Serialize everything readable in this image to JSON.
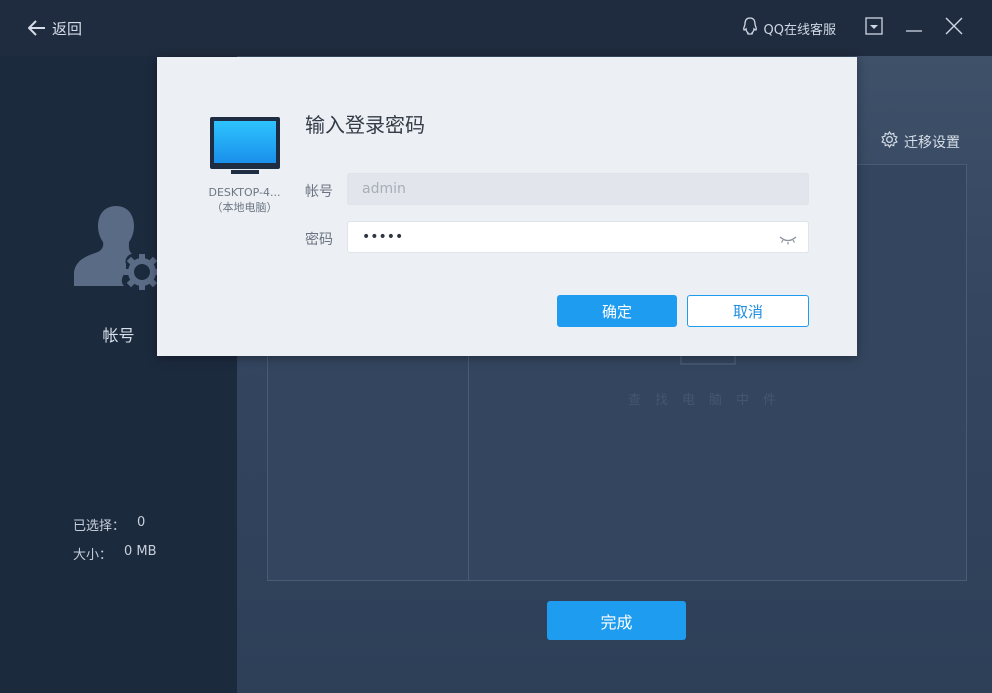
{
  "titlebar": {
    "back_label": "返回",
    "qq_label": "QQ在线客服"
  },
  "left": {
    "account_label": "帐号",
    "selected_label": "已选择：",
    "selected_value": "0",
    "size_label": "大小：",
    "size_value": "0 MB"
  },
  "right": {
    "migrate_label": "迁移设置",
    "empty_text": "查找电脑中件",
    "done_label": "完成"
  },
  "modal": {
    "title": "输入登录密码",
    "device_name": "DESKTOP-4...",
    "device_sub": "（本地电脑）",
    "account_label": "帐号",
    "account_value": "admin",
    "password_label": "密码",
    "password_value": "•••••",
    "ok_label": "确定",
    "cancel_label": "取消"
  },
  "colors": {
    "accent": "#1e9cf0",
    "sidebar": "#1c2a3e",
    "titlebar": "#1f2b3e",
    "modal_bg": "#eceff4"
  },
  "icons": [
    "back-arrow-icon",
    "qq-icon",
    "dropdown-box-icon",
    "minimize-icon",
    "close-icon",
    "user-settings-icon",
    "gear-icon",
    "computer-icon",
    "eye-closed-icon"
  ]
}
